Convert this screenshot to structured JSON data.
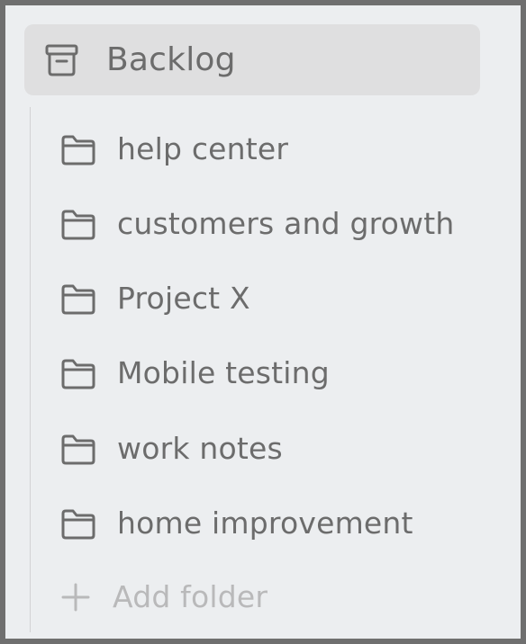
{
  "sidebar": {
    "backlog": {
      "label": "Backlog",
      "icon": "archive-box-icon"
    },
    "folders": [
      {
        "label": "help center",
        "icon": "folder-icon"
      },
      {
        "label": "customers and growth",
        "icon": "folder-icon"
      },
      {
        "label": "Project X",
        "icon": "folder-icon"
      },
      {
        "label": "Mobile testing",
        "icon": "folder-icon"
      },
      {
        "label": "work notes",
        "icon": "folder-icon"
      },
      {
        "label": "home improvement",
        "icon": "folder-icon"
      }
    ],
    "add_folder": {
      "label": "Add folder",
      "icon": "plus-icon"
    }
  },
  "colors": {
    "frame": "#6f6f6f",
    "background": "#eceef0",
    "selected_row": "#dfdfe0",
    "text": "#6c6c6c",
    "muted_text": "#b9b9ba",
    "tree_line": "#d2d2d3"
  }
}
